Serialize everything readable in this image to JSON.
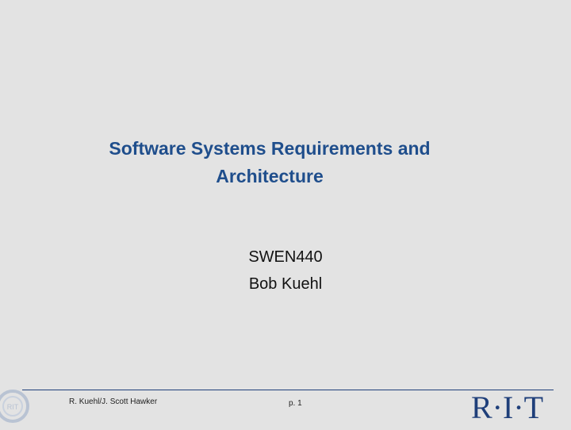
{
  "slide": {
    "title_lines": [
      "Software Systems Requirements and",
      "Architecture"
    ],
    "subtitle_lines": [
      "SWEN440",
      "Bob Kuehl"
    ]
  },
  "footer": {
    "author": "R. Kuehl/J. Scott Hawker",
    "page": "p. 1",
    "logo_text": "R·I·T",
    "seal_text": "RIT"
  },
  "colors": {
    "background": "#e3e3e3",
    "title": "#1f4e8c",
    "brand": "#1f3f7a"
  }
}
